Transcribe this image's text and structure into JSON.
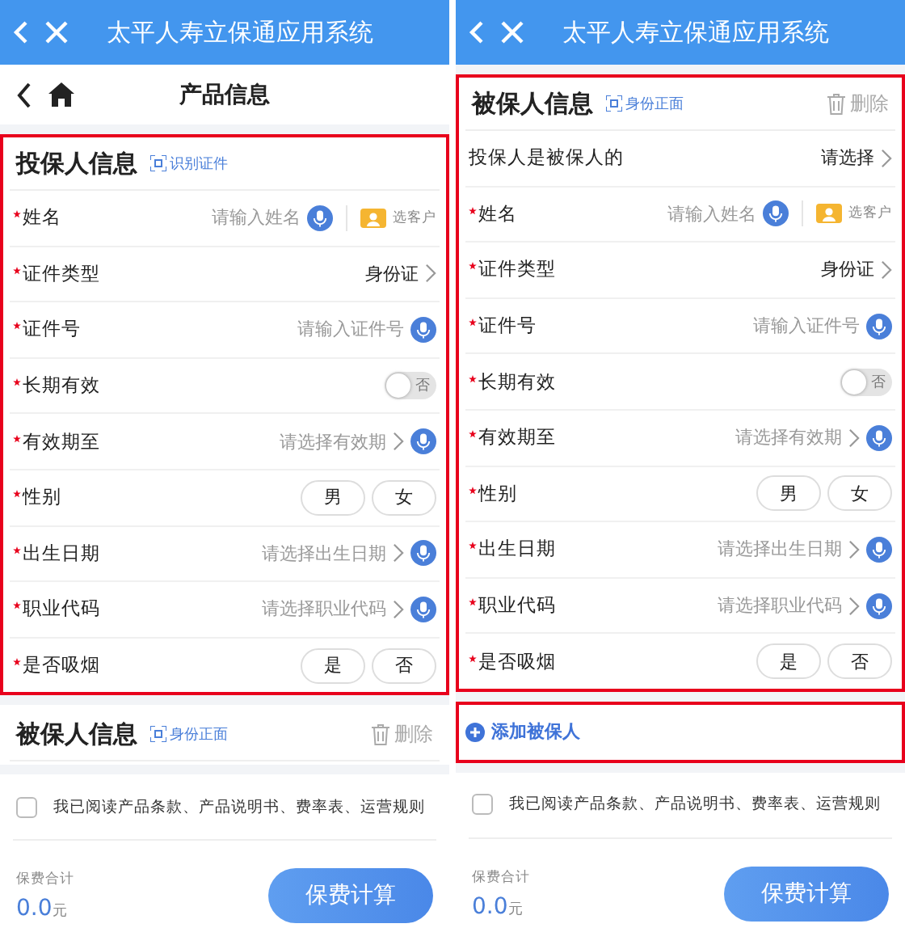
{
  "panels": [
    {
      "app_title": "太平人寿立保通应用系统",
      "nav": {
        "title": "产品信息"
      },
      "sections": [
        {
          "kind": "form",
          "title": "投保人信息",
          "scan_label": "识别证件",
          "highlighted": true,
          "fields": [
            {
              "kind": "input",
              "label": "姓名",
              "required": true,
              "placeholder": "请输入姓名",
              "voice": true,
              "customer_button": "选客户"
            },
            {
              "kind": "select",
              "label": "证件类型",
              "required": true,
              "value": "身份证"
            },
            {
              "kind": "input",
              "label": "证件号",
              "required": true,
              "placeholder": "请输入证件号",
              "voice": true
            },
            {
              "kind": "toggle",
              "label": "长期有效",
              "required": true,
              "on": false,
              "toggle_text": "否"
            },
            {
              "kind": "select",
              "label": "有效期至",
              "required": true,
              "placeholder": "请选择有效期",
              "voice": true
            },
            {
              "kind": "choice",
              "label": "性别",
              "required": true,
              "options": [
                {
                  "label": "男",
                  "selected": false
                },
                {
                  "label": "女",
                  "selected": false
                }
              ]
            },
            {
              "kind": "select",
              "label": "出生日期",
              "required": true,
              "placeholder": "请选择出生日期",
              "voice": true
            },
            {
              "kind": "select",
              "label": "职业代码",
              "required": true,
              "placeholder": "请选择职业代码",
              "voice": true
            },
            {
              "kind": "choice",
              "label": "是否吸烟",
              "required": true,
              "options": [
                {
                  "label": "是",
                  "selected": false
                },
                {
                  "label": "否",
                  "selected": false
                }
              ]
            }
          ]
        },
        {
          "kind": "form",
          "title": "被保人信息",
          "scan_label": "身份正面",
          "delete_label": "删除",
          "highlighted": false
        }
      ],
      "agreement": {
        "text": "我已阅读产品条款、产品说明书、费率表、运营规则",
        "checked": false
      },
      "total": {
        "label": "保费合计",
        "amount": "0.0",
        "unit": "元"
      },
      "submit": "保费计算"
    },
    {
      "app_title": "太平人寿立保通应用系统",
      "sections": [
        {
          "kind": "form",
          "title": "被保人信息",
          "scan_label": "身份正面",
          "delete_label": "删除",
          "highlighted": true,
          "fields": [
            {
              "kind": "select",
              "label": "投保人是被保人的",
              "value": "请选择"
            },
            {
              "kind": "input",
              "label": "姓名",
              "required": true,
              "placeholder": "请输入姓名",
              "voice": true,
              "customer_button": "选客户"
            },
            {
              "kind": "select",
              "label": "证件类型",
              "required": true,
              "value": "身份证"
            },
            {
              "kind": "input",
              "label": "证件号",
              "required": true,
              "placeholder": "请输入证件号",
              "voice": true
            },
            {
              "kind": "toggle",
              "label": "长期有效",
              "required": true,
              "on": false,
              "toggle_text": "否"
            },
            {
              "kind": "select",
              "label": "有效期至",
              "required": true,
              "placeholder": "请选择有效期",
              "voice": true
            },
            {
              "kind": "choice",
              "label": "性别",
              "required": true,
              "options": [
                {
                  "label": "男",
                  "selected": false
                },
                {
                  "label": "女",
                  "selected": false
                }
              ]
            },
            {
              "kind": "select",
              "label": "出生日期",
              "required": true,
              "placeholder": "请选择出生日期",
              "voice": true
            },
            {
              "kind": "select",
              "label": "职业代码",
              "required": true,
              "placeholder": "请选择职业代码",
              "voice": true
            },
            {
              "kind": "choice",
              "label": "是否吸烟",
              "required": true,
              "options": [
                {
                  "label": "是",
                  "selected": false
                },
                {
                  "label": "否",
                  "selected": false
                }
              ]
            }
          ]
        },
        {
          "kind": "add",
          "label": "添加被保人",
          "highlighted": true
        }
      ],
      "agreement": {
        "text": "我已阅读产品条款、产品说明书、费率表、运营规则",
        "checked": false
      },
      "total": {
        "label": "保费合计",
        "amount": "0.0",
        "unit": "元"
      },
      "submit": "保费计算"
    }
  ]
}
